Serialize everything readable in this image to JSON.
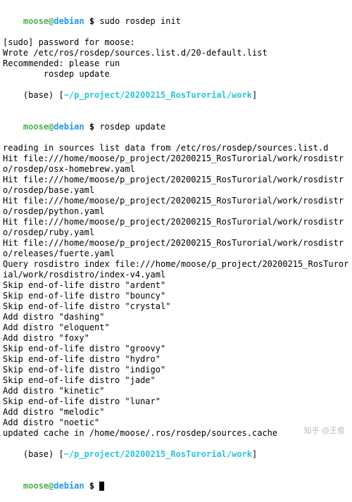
{
  "prompt1": {
    "user": "moose",
    "at": "@",
    "host": "debian",
    "dollar": " $ ",
    "cmd": "sudo rosdep init"
  },
  "lines1": {
    "sudo_pw": "[sudo] password for moose:",
    "wrote": "Wrote /etc/ros/rosdep/sources.list.d/20-default.list",
    "recommended": "Recommended: please run",
    "blank1": "",
    "rosdep_update": "        rosdep update",
    "blank2": ""
  },
  "base1": {
    "base_open": "(base) [",
    "path": "~/p_project/20200215_RosTurorial/work",
    "close": "]"
  },
  "prompt2": {
    "user": "moose",
    "at": "@",
    "host": "debian",
    "dollar": " $ ",
    "cmd": "rosdep update"
  },
  "lines2": {
    "reading": "reading in sources list data from /etc/ros/rosdep/sources.list.d",
    "hit1": "Hit file:///home/moose/p_project/20200215_RosTurorial/work/rosdistro/rosdep/osx-homebrew.yaml",
    "hit2": "Hit file:///home/moose/p_project/20200215_RosTurorial/work/rosdistro/rosdep/base.yaml",
    "hit3": "Hit file:///home/moose/p_project/20200215_RosTurorial/work/rosdistro/rosdep/python.yaml",
    "hit4": "Hit file:///home/moose/p_project/20200215_RosTurorial/work/rosdistro/rosdep/ruby.yaml",
    "hit5": "Hit file:///home/moose/p_project/20200215_RosTurorial/work/rosdistro/releases/fuerte.yaml",
    "query": "Query rosdistro index file:///home/moose/p_project/20200215_RosTurorial/work/rosdistro/index-v4.yaml",
    "d01": "Skip end-of-life distro \"ardent\"",
    "d02": "Skip end-of-life distro \"bouncy\"",
    "d03": "Skip end-of-life distro \"crystal\"",
    "d04": "Add distro \"dashing\"",
    "d05": "Add distro \"eloquent\"",
    "d06": "Add distro \"foxy\"",
    "d07": "Skip end-of-life distro \"groovy\"",
    "d08": "Skip end-of-life distro \"hydro\"",
    "d09": "Skip end-of-life distro \"indigo\"",
    "d10": "Skip end-of-life distro \"jade\"",
    "d11": "Add distro \"kinetic\"",
    "d12": "Skip end-of-life distro \"lunar\"",
    "d13": "Add distro \"melodic\"",
    "d14": "Add distro \"noetic\"",
    "updated": "updated cache in /home/moose/.ros/rosdep/sources.cache"
  },
  "base2": {
    "base_open": "(base) [",
    "path": "~/p_project/20200215_RosTurorial/work",
    "close": "]"
  },
  "prompt3": {
    "user": "moose",
    "at": "@",
    "host": "debian",
    "dollar": " $ "
  },
  "watermark": "知乎 @王俊"
}
